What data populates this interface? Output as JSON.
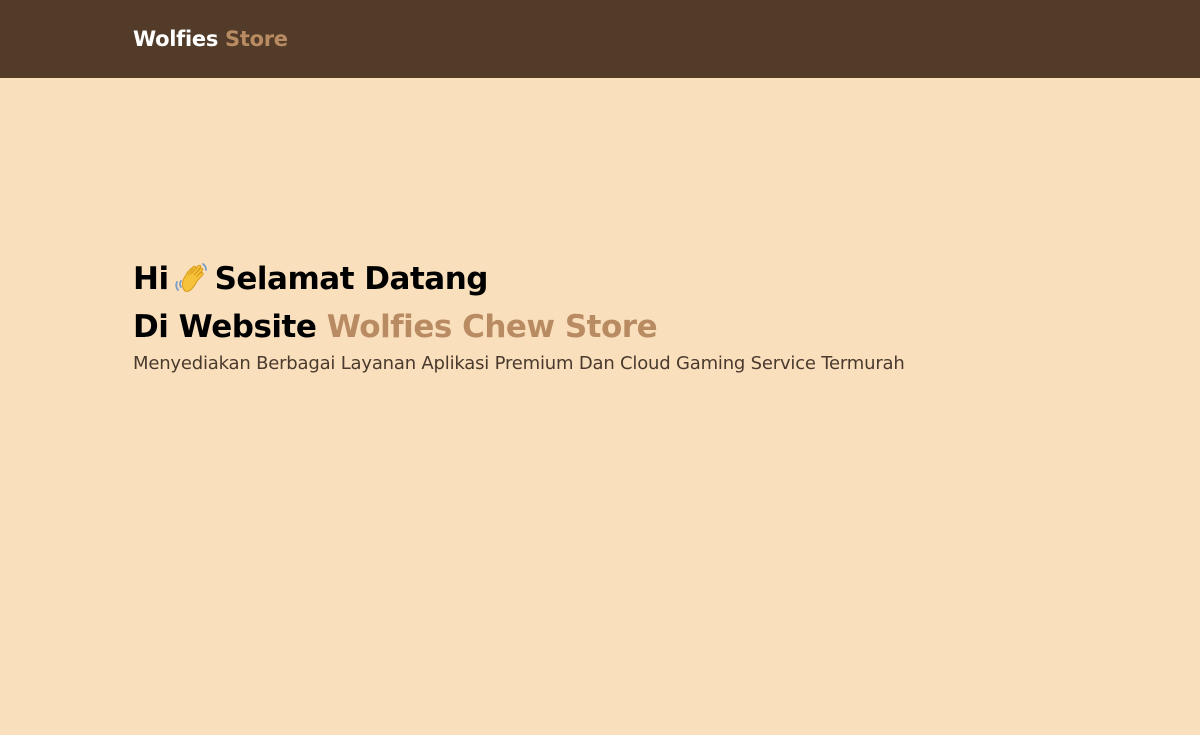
{
  "navbar": {
    "brand_main": "Wolfies",
    "brand_accent": "Store"
  },
  "hero": {
    "greeting": "Hi",
    "greeting_icon": "waving-hand-icon",
    "greeting_rest": "Selamat Datang",
    "line2_prefix": "Di Website",
    "line2_accent": "Wolfies Chew Store",
    "tagline": "Menyediakan Berbagai Layanan Aplikasi Premium Dan Cloud Gaming Service Termurah"
  },
  "colors": {
    "navbar_bg": "#523C29",
    "page_bg": "#F9DFBC",
    "accent": "#B98B62",
    "heading": "#000000",
    "tagline": "#4A3A2E"
  }
}
